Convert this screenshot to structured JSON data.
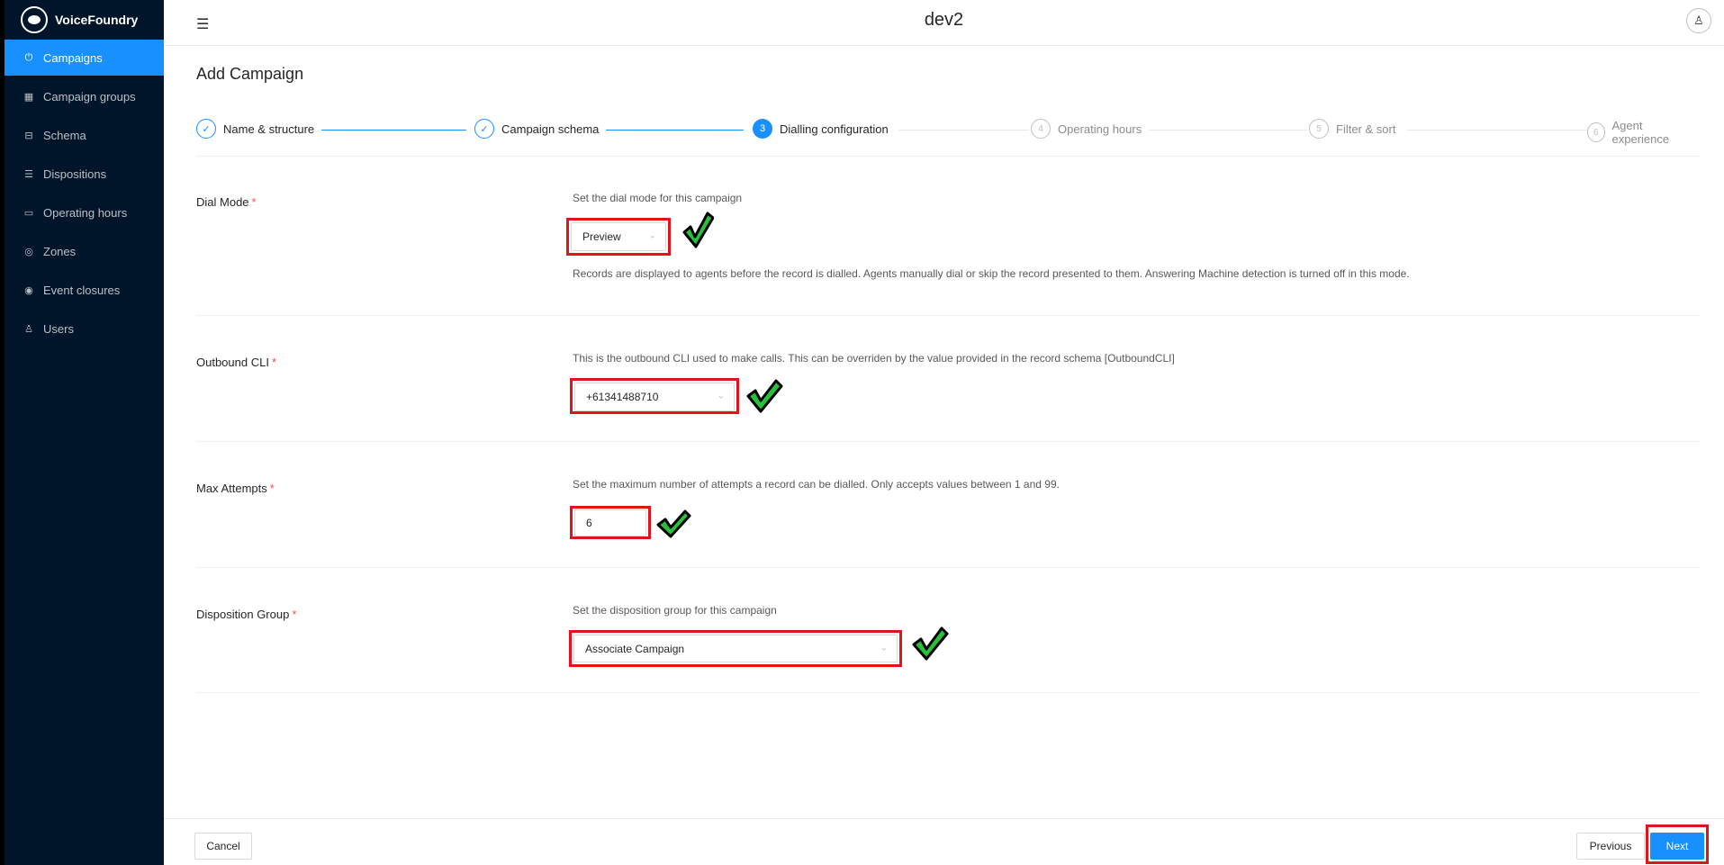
{
  "app": {
    "brand": "VoiceFoundry",
    "environment": "dev2"
  },
  "sidebar": {
    "items": [
      {
        "label": "Campaigns",
        "icon": "power-icon",
        "active": true
      },
      {
        "label": "Campaign groups",
        "icon": "group-icon",
        "active": false
      },
      {
        "label": "Schema",
        "icon": "table-icon",
        "active": false
      },
      {
        "label": "Dispositions",
        "icon": "list-icon",
        "active": false
      },
      {
        "label": "Operating hours",
        "icon": "calendar-icon",
        "active": false
      },
      {
        "label": "Zones",
        "icon": "location-icon",
        "active": false
      },
      {
        "label": "Event closures",
        "icon": "target-icon",
        "active": false
      },
      {
        "label": "Users",
        "icon": "user-icon",
        "active": false
      }
    ]
  },
  "page": {
    "title": "Add Campaign"
  },
  "steps": [
    {
      "number": "1",
      "label": "Name & structure",
      "status": "done"
    },
    {
      "number": "2",
      "label": "Campaign schema",
      "status": "done"
    },
    {
      "number": "3",
      "label": "Dialling configuration",
      "status": "current"
    },
    {
      "number": "4",
      "label": "Operating hours",
      "status": "wait"
    },
    {
      "number": "5",
      "label": "Filter & sort",
      "status": "wait"
    },
    {
      "number": "6",
      "label": "Agent experience",
      "status": "wait"
    }
  ],
  "form": {
    "dial_mode": {
      "label": "Dial Mode",
      "required_mark": "*",
      "help": "Set the dial mode for this campaign",
      "value": "Preview",
      "description": "Records are displayed to agents before the record is dialled. Agents manually dial or skip the record presented to them. Answering Machine detection is turned off in this mode."
    },
    "outbound_cli": {
      "label": "Outbound CLI",
      "required_mark": "*",
      "help": "This is the outbound CLI used to make calls. This can be overriden by the value provided in the record schema [OutboundCLI]",
      "value": "+61341488710"
    },
    "max_attempts": {
      "label": "Max Attempts",
      "required_mark": "*",
      "help": "Set the maximum number of attempts a record can be dialled. Only accepts values between 1 and 99.",
      "value": "6"
    },
    "disposition_group": {
      "label": "Disposition Group",
      "required_mark": "*",
      "help": "Set the disposition group for this campaign",
      "value": "Associate Campaign"
    }
  },
  "footer": {
    "cancel": "Cancel",
    "previous": "Previous",
    "next": "Next"
  },
  "colors": {
    "primary": "#1890ff",
    "sidebar": "#001529",
    "highlight": "#e0141d",
    "check": "#27c13a"
  }
}
